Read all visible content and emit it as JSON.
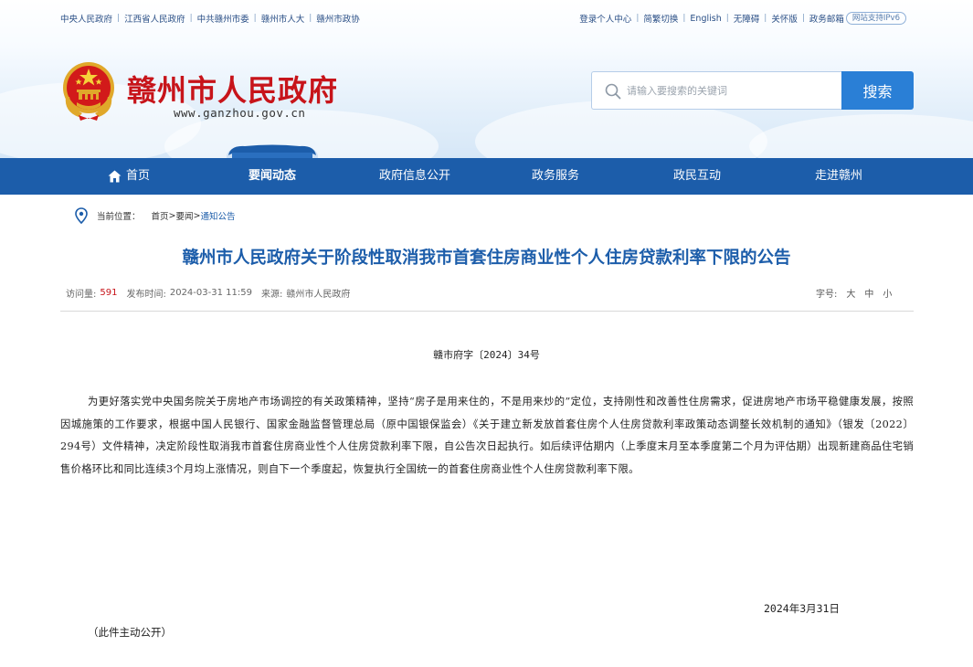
{
  "topbar": {
    "left_links": [
      "中央人民政府",
      "江西省人民政府",
      "中共赣州市委",
      "赣州市人大",
      "赣州市政协"
    ],
    "right_links": [
      "登录个人中心",
      "简繁切换",
      "English",
      "无障碍",
      "关怀版",
      "政务邮箱"
    ],
    "ipv6": "网站支持IPv6"
  },
  "header": {
    "site_title": "赣州市人民政府",
    "site_url": "www.ganzhou.gov.cn",
    "emblem_icon": "national-emblem-icon"
  },
  "search": {
    "placeholder": "请输入要搜索的关键词",
    "button": "搜索"
  },
  "nav": {
    "items": [
      "首页",
      "要闻动态",
      "政府信息公开",
      "政务服务",
      "政民互动",
      "走进赣州"
    ],
    "active_index": 1
  },
  "breadcrumb": {
    "label": "当前位置：",
    "items": [
      "首页",
      "要闻",
      "通知公告"
    ],
    "separator": ">"
  },
  "article": {
    "title": "赣州市人民政府关于阶段性取消我市首套住房商业性个人住房贷款利率下限的公告",
    "views_label": "访问量:",
    "views": "591",
    "publish_label": "发布时间:",
    "publish_time": "2024-03-31 11:59",
    "source_label": "来源:",
    "source": "赣州市人民政府",
    "fontsize_label": "字号:",
    "fontsize_options": [
      "大",
      "中",
      "小"
    ],
    "doc_number": "赣市府字〔2024〕34号",
    "body": "为更好落实党中央国务院关于房地产市场调控的有关政策精神，坚持“房子是用来住的，不是用来炒的”定位，支持刚性和改善性住房需求，促进房地产市场平稳健康发展，按照因城施策的工作要求，根据中国人民银行、国家金融监督管理总局（原中国银保监会）《关于建立新发放首套住房个人住房贷款利率政策动态调整长效机制的通知》（银发〔2022〕294号）文件精神，决定阶段性取消我市首套住房商业性个人住房贷款利率下限，自公告次日起执行。如后续评估期内（上季度末月至本季度第二个月为评估期）出现新建商品住宅销售价格环比和同比连续3个月均上涨情况，则自下一个季度起，恢复执行全国统一的首套住房商业性个人住房贷款利率下限。",
    "sign_date": "2024年3月31日",
    "public_note": "（此件主动公开）"
  },
  "colors": {
    "primary_blue": "#1c5daa",
    "title_red": "#c7141a",
    "search_blue": "#2a7fd6"
  }
}
